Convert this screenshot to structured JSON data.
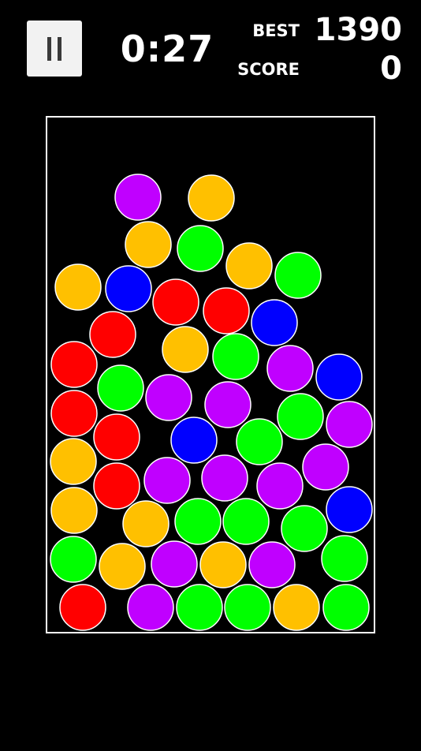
{
  "hud": {
    "pause_icon": "pause-icon",
    "timer": "0:27",
    "best_label": "BEST",
    "best_value": "1390",
    "score_label": "SCORE",
    "score_value": "0"
  },
  "colors": {
    "purple": "#c000ff",
    "orange": "#ffc000",
    "green": "#00ff00",
    "blue": "#0000ff",
    "red": "#ff0000",
    "outline": "#ffffff",
    "background": "#000000"
  },
  "balls": [
    "purple",
    "orange",
    "orange",
    "green",
    "orange",
    "green",
    "orange",
    "blue",
    "red",
    "red",
    "blue",
    "red",
    "orange",
    "green",
    "purple",
    "blue",
    "red",
    "green",
    "purple",
    "purple",
    "red",
    "red",
    "blue",
    "green",
    "green",
    "purple",
    "orange",
    "red",
    "purple",
    "purple",
    "purple",
    "purple",
    "orange",
    "orange",
    "green",
    "green",
    "green",
    "blue",
    "green",
    "orange",
    "purple",
    "orange",
    "purple",
    "green",
    "red",
    "purple",
    "green",
    "green",
    "orange",
    "green"
  ]
}
